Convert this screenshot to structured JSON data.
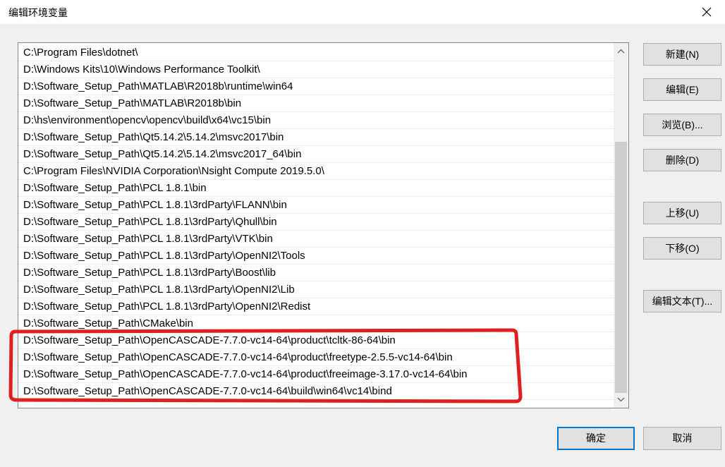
{
  "window": {
    "title": "编辑环境变量",
    "close_icon": "close-icon"
  },
  "path_list": {
    "entries": [
      "C:\\Program Files\\dotnet\\",
      "D:\\Windows Kits\\10\\Windows Performance Toolkit\\",
      "D:\\Software_Setup_Path\\MATLAB\\R2018b\\runtime\\win64",
      "D:\\Software_Setup_Path\\MATLAB\\R2018b\\bin",
      "D:\\hs\\environment\\opencv\\opencv\\build\\x64\\vc15\\bin",
      "D:\\Software_Setup_Path\\Qt5.14.2\\5.14.2\\msvc2017\\bin",
      "D:\\Software_Setup_Path\\Qt5.14.2\\5.14.2\\msvc2017_64\\bin",
      "C:\\Program Files\\NVIDIA Corporation\\Nsight Compute 2019.5.0\\",
      "D:\\Software_Setup_Path\\PCL 1.8.1\\bin",
      "D:\\Software_Setup_Path\\PCL 1.8.1\\3rdParty\\FLANN\\bin",
      "D:\\Software_Setup_Path\\PCL 1.8.1\\3rdParty\\Qhull\\bin",
      "D:\\Software_Setup_Path\\PCL 1.8.1\\3rdParty\\VTK\\bin",
      "D:\\Software_Setup_Path\\PCL 1.8.1\\3rdParty\\OpenNI2\\Tools",
      "D:\\Software_Setup_Path\\PCL 1.8.1\\3rdParty\\Boost\\lib",
      "D:\\Software_Setup_Path\\PCL 1.8.1\\3rdParty\\OpenNI2\\Lib",
      "D:\\Software_Setup_Path\\PCL 1.8.1\\3rdParty\\OpenNI2\\Redist",
      "D:\\Software_Setup_Path\\CMake\\bin",
      "D:\\Software_Setup_Path\\OpenCASCADE-7.7.0-vc14-64\\product\\tcltk-86-64\\bin",
      "D:\\Software_Setup_Path\\OpenCASCADE-7.7.0-vc14-64\\product\\freetype-2.5.5-vc14-64\\bin",
      "D:\\Software_Setup_Path\\OpenCASCADE-7.7.0-vc14-64\\product\\freeimage-3.17.0-vc14-64\\bin",
      "D:\\Software_Setup_Path\\OpenCASCADE-7.7.0-vc14-64\\build\\win64\\vc14\\bind"
    ]
  },
  "side_buttons": {
    "new": "新建(N)",
    "edit": "编辑(E)",
    "browse": "浏览(B)...",
    "delete": "删除(D)",
    "move_up": "上移(U)",
    "move_down": "下移(O)",
    "edit_text": "编辑文本(T)..."
  },
  "footer": {
    "ok": "确定",
    "cancel": "取消"
  },
  "colors": {
    "highlight": "#e02020",
    "ok_border": "#0078d7"
  }
}
